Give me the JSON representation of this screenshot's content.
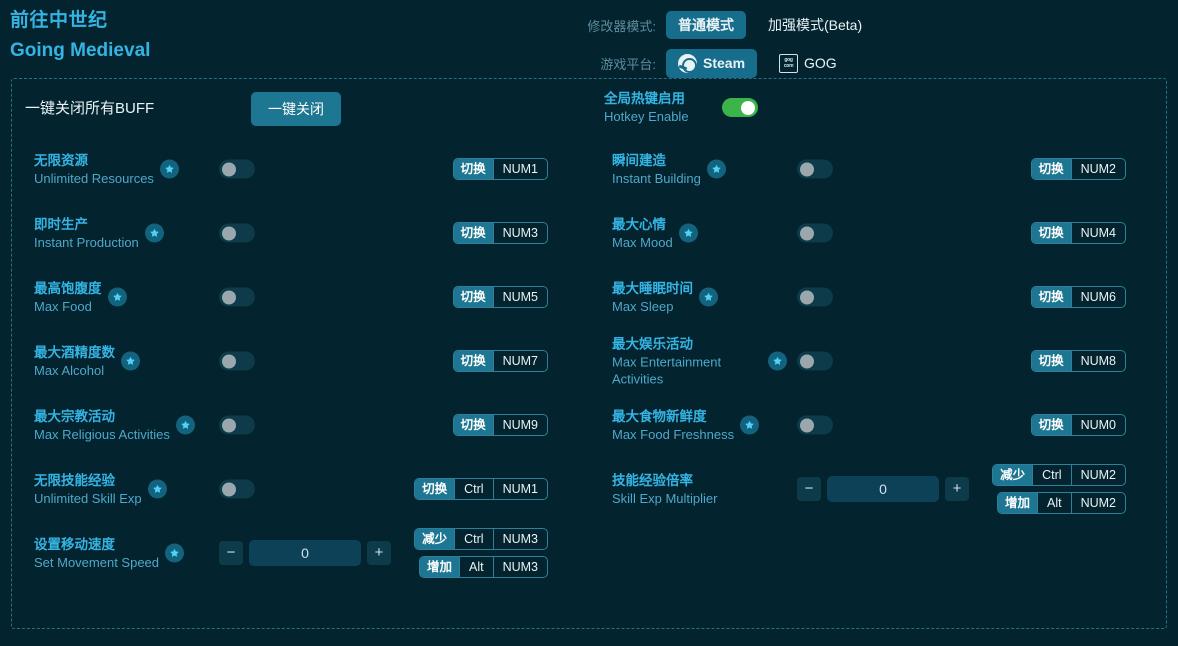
{
  "header": {
    "title_cn": "前往中世纪",
    "title_en": "Going Medieval",
    "mode_row_label": "修改器模式:",
    "mode_options": [
      {
        "label": "普通模式",
        "active": true,
        "icon": ""
      },
      {
        "label": "加强模式(Beta)",
        "active": false,
        "icon": ""
      }
    ],
    "platform_row_label": "游戏平台:",
    "platform_options": [
      {
        "label": "Steam",
        "active": true,
        "icon": "steam-icon"
      },
      {
        "label": "GOG",
        "active": false,
        "icon": "gog-icon"
      }
    ]
  },
  "panel_top": {
    "close_all_label": "一键关闭所有BUFF",
    "close_all_button": "一键关闭",
    "hotkey_cn": "全局热键启用",
    "hotkey_en": "Hotkey Enable",
    "hotkey_state": "on"
  },
  "colors": {
    "background": "#03242f",
    "accent": "#35b4e4",
    "accent_dim": "#4fa7c9",
    "button": "#1d7692",
    "toggle_on": "#3bb54a",
    "toggle_off": "#0d3b4a",
    "border_dashed": "#2b6e86",
    "star_badge": "#13637e",
    "text_light": "#e9f3f6"
  },
  "left_column": [
    {
      "name_cn": "无限资源",
      "name_en": "Unlimited Resources",
      "star": true,
      "control": "toggle",
      "toggle_state": "off",
      "hotkeys": [
        {
          "action": "切换",
          "keys": [
            "NUM1"
          ]
        }
      ]
    },
    {
      "name_cn": "即时生产",
      "name_en": "Instant Production",
      "star": true,
      "control": "toggle",
      "toggle_state": "off",
      "hotkeys": [
        {
          "action": "切换",
          "keys": [
            "NUM3"
          ]
        }
      ]
    },
    {
      "name_cn": "最高饱腹度",
      "name_en": "Max Food",
      "star": true,
      "control": "toggle",
      "toggle_state": "off",
      "hotkeys": [
        {
          "action": "切换",
          "keys": [
            "NUM5"
          ]
        }
      ]
    },
    {
      "name_cn": "最大酒精度数",
      "name_en": "Max Alcohol",
      "star": true,
      "control": "toggle",
      "toggle_state": "off",
      "hotkeys": [
        {
          "action": "切换",
          "keys": [
            "NUM7"
          ]
        }
      ]
    },
    {
      "name_cn": "最大宗教活动",
      "name_en": "Max Religious Activities",
      "star": true,
      "control": "toggle",
      "toggle_state": "off",
      "hotkeys": [
        {
          "action": "切换",
          "keys": [
            "NUM9"
          ]
        }
      ]
    },
    {
      "name_cn": "无限技能经验",
      "name_en": "Unlimited Skill Exp",
      "star": true,
      "control": "toggle",
      "toggle_state": "off",
      "hotkeys": [
        {
          "action": "切换",
          "keys": [
            "Ctrl",
            "NUM1"
          ]
        }
      ]
    },
    {
      "name_cn": "设置移动速度",
      "name_en": "Set Movement Speed",
      "star": true,
      "control": "stepper",
      "value": "0",
      "minus_label": "−",
      "plus_label": "+",
      "hotkeys": [
        {
          "action": "减少",
          "keys": [
            "Ctrl",
            "NUM3"
          ]
        },
        {
          "action": "增加",
          "keys": [
            "Alt",
            "NUM3"
          ]
        }
      ]
    }
  ],
  "right_column": [
    {
      "name_cn": "瞬间建造",
      "name_en": "Instant Building",
      "star": true,
      "control": "toggle",
      "toggle_state": "off",
      "hotkeys": [
        {
          "action": "切换",
          "keys": [
            "NUM2"
          ]
        }
      ]
    },
    {
      "name_cn": "最大心情",
      "name_en": "Max Mood",
      "star": true,
      "control": "toggle",
      "toggle_state": "off",
      "hotkeys": [
        {
          "action": "切换",
          "keys": [
            "NUM4"
          ]
        }
      ]
    },
    {
      "name_cn": "最大睡眠时间",
      "name_en": "Max Sleep",
      "star": true,
      "control": "toggle",
      "toggle_state": "off",
      "hotkeys": [
        {
          "action": "切换",
          "keys": [
            "NUM6"
          ]
        }
      ]
    },
    {
      "name_cn": "最大娱乐活动",
      "name_en": "Max Entertainment Activities",
      "star": true,
      "control": "toggle",
      "toggle_state": "off",
      "hotkeys": [
        {
          "action": "切换",
          "keys": [
            "NUM8"
          ]
        }
      ]
    },
    {
      "name_cn": "最大食物新鲜度",
      "name_en": "Max Food Freshness",
      "star": true,
      "control": "toggle",
      "toggle_state": "off",
      "hotkeys": [
        {
          "action": "切换",
          "keys": [
            "NUM0"
          ]
        }
      ]
    },
    {
      "name_cn": "技能经验倍率",
      "name_en": "Skill Exp Multiplier",
      "star": false,
      "control": "stepper",
      "value": "0",
      "minus_label": "−",
      "plus_label": "+",
      "hotkeys": [
        {
          "action": "减少",
          "keys": [
            "Ctrl",
            "NUM2"
          ]
        },
        {
          "action": "增加",
          "keys": [
            "Alt",
            "NUM2"
          ]
        }
      ]
    }
  ]
}
